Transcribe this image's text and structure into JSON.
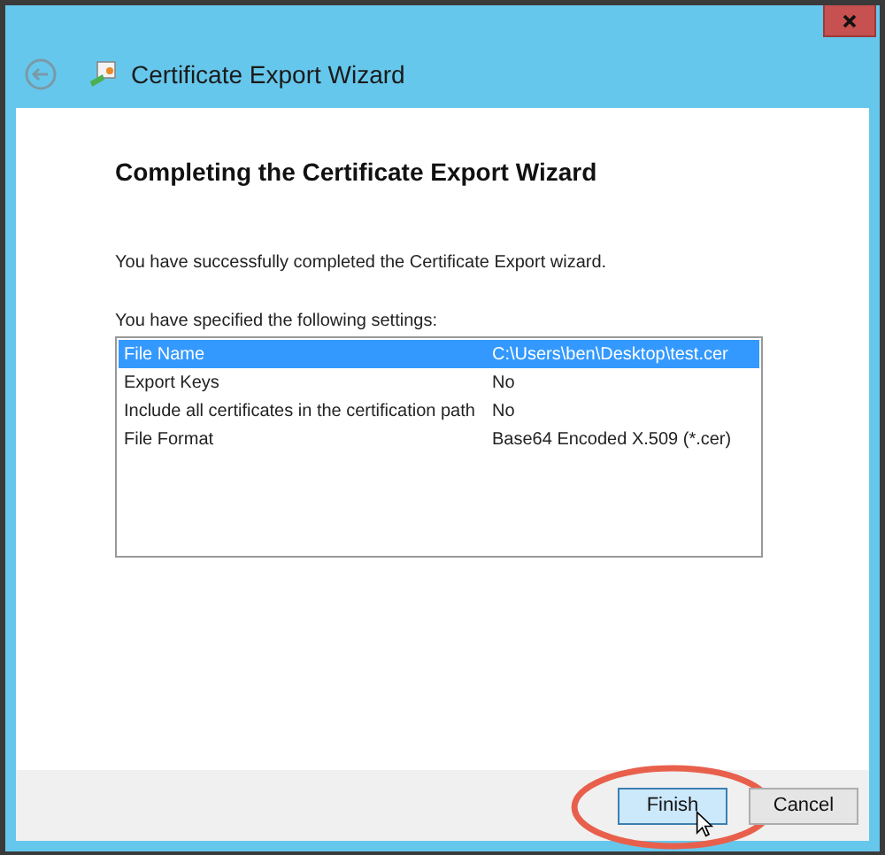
{
  "window": {
    "title": "Certificate Export Wizard"
  },
  "heading": "Completing the Certificate Export Wizard",
  "message": "You have successfully completed the Certificate Export wizard.",
  "settings_label": "You have specified the following settings:",
  "settings": [
    {
      "name": "File Name",
      "value": "C:\\Users\\ben\\Desktop\\test.cer",
      "selected": true
    },
    {
      "name": "Export Keys",
      "value": "No",
      "selected": false
    },
    {
      "name": "Include all certificates in the certification path",
      "value": "No",
      "selected": false
    },
    {
      "name": "File Format",
      "value": "Base64 Encoded X.509 (*.cer)",
      "selected": false
    }
  ],
  "buttons": [
    {
      "label": "Finish",
      "hovered": true,
      "circled": true
    },
    {
      "label": "Cancel",
      "hovered": false,
      "circled": false
    }
  ]
}
